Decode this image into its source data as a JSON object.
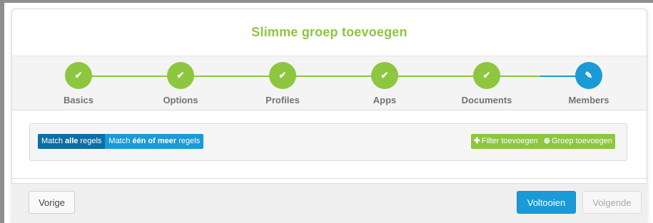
{
  "modal": {
    "title": "Slimme groep toevoegen"
  },
  "wizard": {
    "steps": [
      {
        "label": "Basics",
        "state": "done",
        "icon": "check-icon"
      },
      {
        "label": "Options",
        "state": "done",
        "icon": "check-icon"
      },
      {
        "label": "Profiles",
        "state": "done",
        "icon": "check-icon"
      },
      {
        "label": "Apps",
        "state": "done",
        "icon": "check-icon"
      },
      {
        "label": "Documents",
        "state": "done",
        "icon": "check-icon"
      },
      {
        "label": "Members",
        "state": "active",
        "icon": "pencil-icon"
      }
    ]
  },
  "rules": {
    "match_all": {
      "prefix": "Match ",
      "bold": "alle",
      "suffix": " regels"
    },
    "match_one": {
      "prefix": "Match ",
      "bold": "één of meer",
      "suffix": " regels"
    },
    "add_filter": "Filter toevoegen",
    "add_filter_icon": "plus-icon",
    "add_group": "Groep toevoegen",
    "add_group_icon": "plus-circle-icon"
  },
  "footer": {
    "prev": "Vorige",
    "finish": "Voltooien",
    "next": "Volgende"
  },
  "colors": {
    "green": "#8dc63f",
    "blue": "#1a9ad6",
    "dark_blue": "#0d6ea3"
  }
}
